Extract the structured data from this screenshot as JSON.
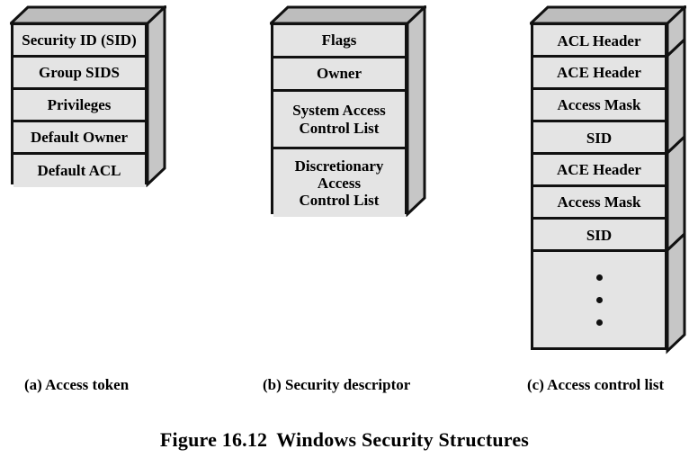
{
  "figure": {
    "title_number": "Figure 16.12",
    "title_text": "Windows Security Structures",
    "background_color": "#ffffff",
    "front_face_color": "#e4e4e4",
    "top_face_color": "#bdbdbd",
    "right_face_color": "#c6c6c6",
    "outline_color": "#111111"
  },
  "panels": [
    {
      "id": "access-token",
      "caption": "(a) Access token",
      "rows": [
        {
          "label": "Security ID (SID)"
        },
        {
          "label": "Group SIDS"
        },
        {
          "label": "Privileges"
        },
        {
          "label": "Default Owner"
        },
        {
          "label": "Default ACL"
        }
      ]
    },
    {
      "id": "security-descriptor",
      "caption": "(b) Security descriptor",
      "rows": [
        {
          "label": "Flags"
        },
        {
          "label": "Owner"
        },
        {
          "label": "System Access\nControl List"
        },
        {
          "label": "Discretionary\nAccess\nControl List"
        }
      ]
    },
    {
      "id": "access-control-list",
      "caption": "(c) Access control list",
      "rows": [
        {
          "label": "ACL Header"
        },
        {
          "label": "ACE Header"
        },
        {
          "label": "Access Mask"
        },
        {
          "label": "SID"
        },
        {
          "label": "ACE Header"
        },
        {
          "label": "Access Mask"
        },
        {
          "label": "SID"
        },
        {
          "label": ""
        }
      ],
      "continuation_dots": 3
    }
  ]
}
